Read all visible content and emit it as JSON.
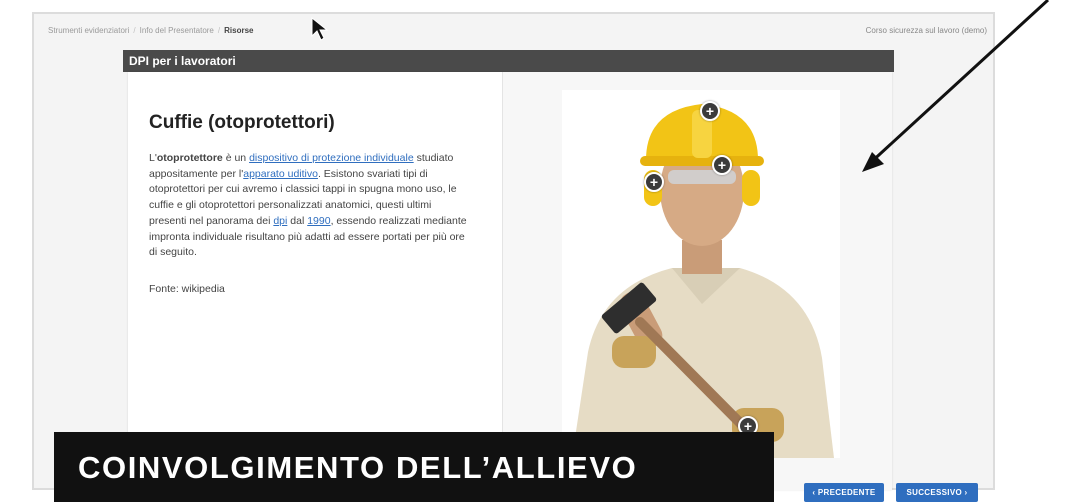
{
  "breadcrumb": {
    "items": [
      "Strumenti evidenziatori",
      "Info del Presentatore",
      "Risorse"
    ]
  },
  "course_title": "Corso sicurezza sul lavoro (demo)",
  "slide": {
    "header": "DPI per i lavoratori",
    "title": "Cuffie (otoprotettori)",
    "paragraph": {
      "p1": "L'",
      "b1": "otoprotettore",
      "p2": " è un ",
      "l1": "dispositivo di protezione individuale",
      "p3": " studiato appositamente per l'",
      "l2": "apparato uditivo",
      "p4": ". Esistono svariati tipi di otoprotettori per cui avremo i classici tappi in spugna mono uso, le cuffie e gli otoprotettori personalizzati anatomici, questi ultimi presenti nel panorama dei ",
      "l3": "dpi",
      "p5": " dal ",
      "l4": "1990",
      "p6": ", essendo realizzati mediante impronta individuale risultano più adatti ad essere portati per più ore di seguito."
    },
    "source": "Fonte: wikipedia"
  },
  "hotspot_symbol": "+",
  "navigation": {
    "prev_label": "‹ PRECEDENTE",
    "next_label": "SUCCESSIVO ›"
  },
  "banner_text": "COINVOLGIMENTO DELL’ALLIEVO",
  "colors": {
    "accent_blue": "#2f6ebf",
    "header_bar": "#4a4a4a",
    "helmet_yellow": "#f2c416",
    "banner_black": "#111111"
  }
}
